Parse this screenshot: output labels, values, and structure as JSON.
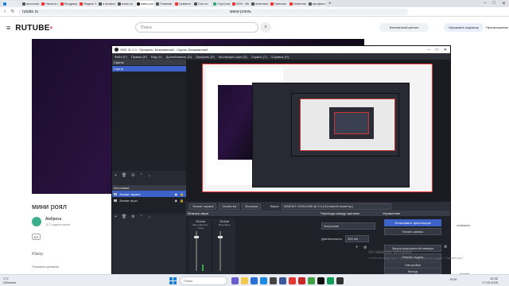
{
  "browser": {
    "tabs": [
      {
        "label": "",
        "color": "#1e7fd6"
      },
      {
        "label": "accounts",
        "color": "#555"
      },
      {
        "label": "Начало игр",
        "color": "#e33"
      },
      {
        "label": "Входящие",
        "color": "#e33"
      },
      {
        "label": "Яндекс М",
        "color": "#e33"
      },
      {
        "label": "4 вопрос",
        "color": "#555"
      },
      {
        "label": "wudu.ru",
        "color": "#555"
      },
      {
        "label": "мини рояль",
        "color": "#2a2a2a",
        "active": true
      },
      {
        "label": "Главная",
        "color": "#555"
      },
      {
        "label": "Гравити",
        "color": "#e33"
      },
      {
        "label": "Сок ло",
        "color": "#555"
      },
      {
        "label": "CopCode",
        "color": "#3a7"
      },
      {
        "label": "30% - Ве",
        "color": "#e33"
      },
      {
        "label": "Анатомия",
        "color": "#555"
      },
      {
        "label": "Напитки",
        "color": "#e33"
      },
      {
        "label": "Nintendo",
        "color": "#e33"
      },
      {
        "label": "профиль",
        "color": "#555"
      }
    ],
    "url": "rutube.ru",
    "page_title": "мини рояль",
    "new_tab": "+",
    "controls": [
      "–",
      "□",
      "✕"
    ]
  },
  "rutube": {
    "logo": "RUTUBE",
    "search_placeholder": "Поиск",
    "free_btn": "Бесплатный регион",
    "subscribe_btn": "Оформить подписку",
    "login_btn": "Произношение",
    "video_title": "мини роял",
    "channel_name": "Амбреха",
    "channel_subs": "117 подписчиков",
    "age_badge": "12+",
    "category": "Юмор",
    "show_more": "Показать целиком",
    "side_1": "отменить",
    "side_2": "откуда"
  },
  "obs": {
    "title": "OBS 31.1.0 - Профиль: Безымянный - Сцены: Безымянный",
    "menu": [
      "Файл (F)",
      "Правка (E)",
      "Вид (V)",
      "Доктаблевать (D)",
      "Профиль (P)",
      "Коллекция сцен (S)",
      "Сервис (T)",
      "Справка (H)"
    ],
    "scenes_header": "Сцены",
    "scenes": [
      "Сцена"
    ],
    "sources_header": "Источники",
    "sources": [
      {
        "label": "Захват экрана",
        "selected": true
      },
      {
        "label": "Захват игры",
        "selected": false
      }
    ],
    "preview_buttons": [
      "Захват экрана",
      "Свойства",
      "Фильтры"
    ],
    "screen_label": "Экран",
    "screen_value": "ЗАЧЕКО 1920x1080 @ 0,0 (Основной монитор)",
    "mixer_header": "Микшер звука",
    "mixer_channels": [
      {
        "name": "Global",
        "sub": "Звук рабочего стола",
        "level": 0.15
      },
      {
        "name": "Global",
        "sub": "Микрофон",
        "level": 0.0
      }
    ],
    "transitions_header": "Переходы между сценами",
    "transition_value": "Затухание",
    "duration_label": "Длительность",
    "duration_value": "300 ms",
    "controls_header": "Управление",
    "control_buttons": [
      "Остановить трансляцию",
      "Начать запись",
      "Запуск виртуальной камеры",
      "Режим студии",
      "Настройки",
      "Выход"
    ]
  },
  "windows": {
    "activation_title": "Активация Windows",
    "activation_sub": "Чтобы активировать Windows, перейдите в раздел \"Параметры\".",
    "weather_temp": "1°C",
    "weather_desc": "Облачно",
    "search_placeholder": "Поиск",
    "time": "15:32",
    "date": "17.03.2025",
    "tray": "RUS"
  }
}
